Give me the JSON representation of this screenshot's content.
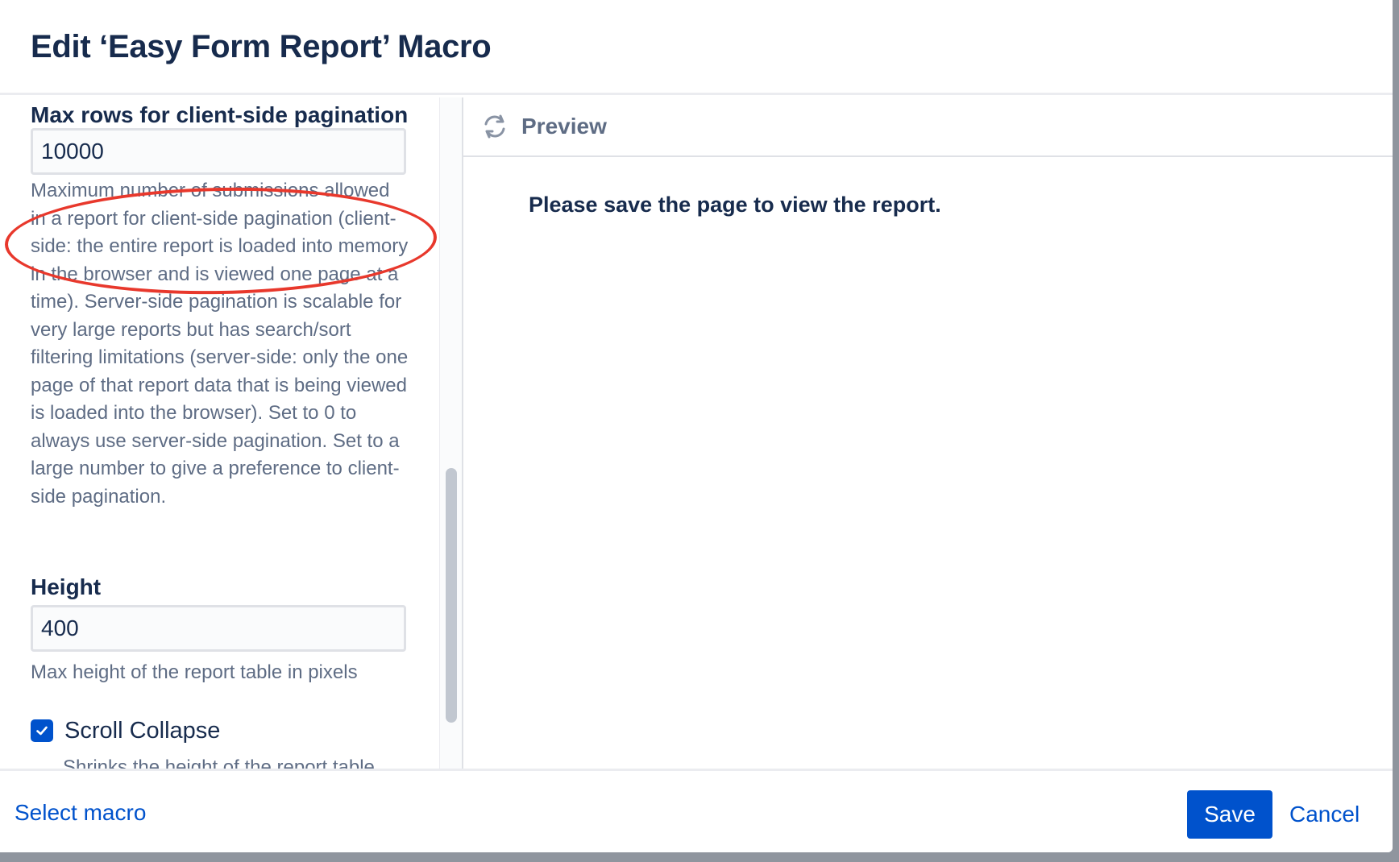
{
  "dialog": {
    "title": "Edit ‘Easy Form Report’ Macro"
  },
  "fields": {
    "max_rows": {
      "label": "Max rows for client-side pagination",
      "value": "10000",
      "description": "Maximum number of submissions allowed in a report for client-side pagination (client-side: the entire report is loaded into memory in the browser and is viewed one page at a time). Server-side pagination is scalable for very large reports but has search/sort filtering limitations (server-side: only the one page of that report data that is being viewed is loaded into the browser). Set to 0 to always use server-side pagination. Set to a large number to give a preference to client-side pagination."
    },
    "height": {
      "label": "Height",
      "value": "400",
      "description": "Max height of the report table in pixels"
    },
    "scroll_collapse": {
      "label": "Scroll Collapse",
      "checked": true,
      "description_partial": "Shrinks the height of the report table"
    }
  },
  "preview": {
    "label": "Preview",
    "message": "Please save the page to view the report."
  },
  "footer": {
    "select_macro": "Select macro",
    "save": "Save",
    "cancel": "Cancel"
  },
  "colors": {
    "primary": "#0052cc",
    "text": "#172b4d",
    "muted": "#5e6c84",
    "annotation": "#e8382c"
  },
  "icons": {
    "refresh": "refresh-icon",
    "check": "checkmark-icon"
  }
}
